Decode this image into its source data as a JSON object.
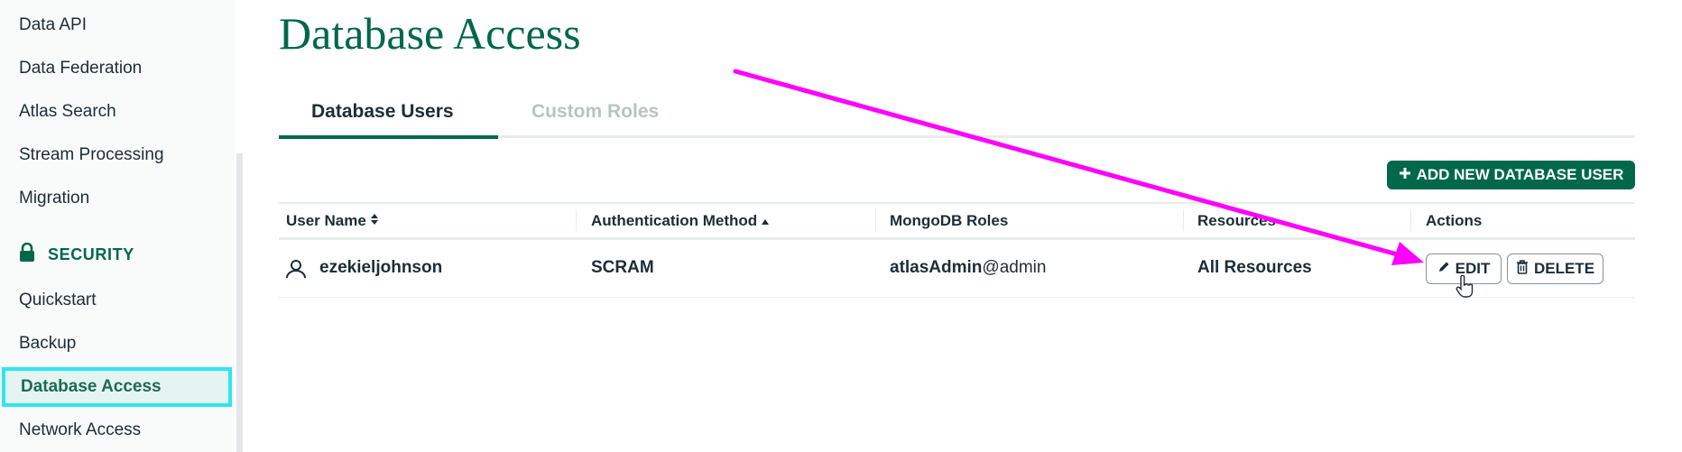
{
  "sidebar": {
    "items_top": [
      "Data API",
      "Data Federation",
      "Atlas Search",
      "Stream Processing",
      "Migration"
    ],
    "section_label": "SECURITY",
    "section_icon": "lock-icon",
    "items_security": [
      "Quickstart",
      "Backup",
      "Database Access",
      "Network Access"
    ],
    "active_item": "Database Access"
  },
  "header": {
    "title": "Database Access"
  },
  "tabs": [
    {
      "label": "Database Users",
      "active": true
    },
    {
      "label": "Custom Roles",
      "active": false
    }
  ],
  "toolbar": {
    "add_button_label": "ADD NEW DATABASE USER"
  },
  "table": {
    "columns": [
      "User Name",
      "Authentication Method",
      "MongoDB Roles",
      "Resources",
      "Actions"
    ],
    "rows": [
      {
        "user_name": "ezekieljohnson",
        "auth_method": "SCRAM",
        "role_name": "atlasAdmin",
        "role_db": "@admin",
        "resources": "All Resources",
        "edit_label": "EDIT",
        "delete_label": "DELETE"
      }
    ]
  },
  "colors": {
    "brand_green": "#00684a",
    "highlight_cyan": "#2fe6ee",
    "annotation_arrow": "#ff00ff",
    "tab_inactive": "#b8c4c2"
  }
}
